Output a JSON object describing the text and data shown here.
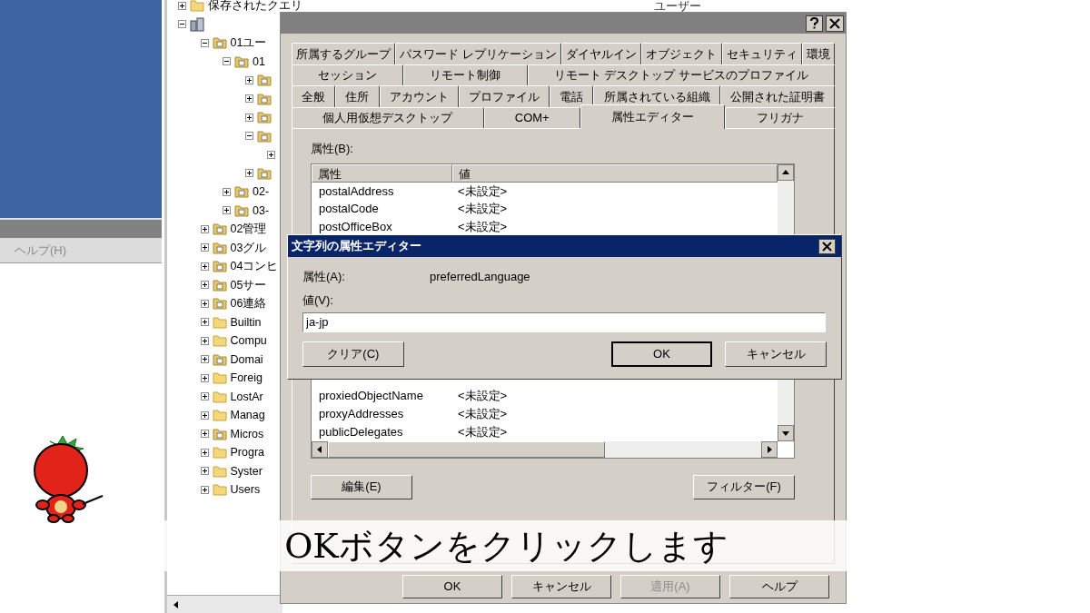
{
  "left_window": {
    "menu": [
      {
        "label": "ヘルプ(H)",
        "disabled": true
      }
    ]
  },
  "tree": [
    {
      "label": "保存されたクエリ",
      "kind": "folder",
      "expanded": false
    },
    {
      "kind": "domain",
      "expanded": true,
      "children": [
        {
          "label": "01ユー",
          "kind": "ou",
          "expanded": true,
          "children": [
            {
              "label": "01",
              "kind": "ou",
              "expanded": true,
              "children": [
                {
                  "kind": "ou",
                  "expanded": false
                },
                {
                  "kind": "ou",
                  "expanded": false
                },
                {
                  "kind": "ou",
                  "expanded": false
                },
                {
                  "kind": "ou",
                  "expanded": true,
                  "children": [
                    {
                      "expanded": false
                    }
                  ]
                },
                {
                  "kind": "ou",
                  "expanded": false
                }
              ]
            },
            {
              "label": "02-",
              "kind": "ou",
              "expanded": false
            },
            {
              "label": "03-",
              "kind": "ou",
              "expanded": false
            }
          ]
        },
        {
          "label": "02管理",
          "kind": "ou",
          "expanded": false
        },
        {
          "label": "03グル",
          "kind": "ou",
          "expanded": false
        },
        {
          "label": "04コンヒ",
          "kind": "ou",
          "expanded": false
        },
        {
          "label": "05サー",
          "kind": "ou",
          "expanded": false
        },
        {
          "label": "06連絡",
          "kind": "ou",
          "expanded": false
        },
        {
          "label": "Builtin",
          "kind": "folder",
          "expanded": false
        },
        {
          "label": "Compu",
          "kind": "folder",
          "expanded": false
        },
        {
          "label": "Domai",
          "kind": "ou",
          "expanded": false
        },
        {
          "label": "Foreig",
          "kind": "folder",
          "expanded": false
        },
        {
          "label": "LostAr",
          "kind": "folder",
          "expanded": false
        },
        {
          "label": "Manag",
          "kind": "folder",
          "expanded": false
        },
        {
          "label": "Micros",
          "kind": "ou",
          "expanded": false
        },
        {
          "label": "Progra",
          "kind": "folder",
          "expanded": false
        },
        {
          "label": "Syster",
          "kind": "folder",
          "expanded": false
        },
        {
          "label": "Users",
          "kind": "folder",
          "expanded": false
        }
      ]
    }
  ],
  "right_pane": {
    "column_header": "ユーザー"
  },
  "properties_dialog": {
    "tab_rows": [
      [
        {
          "label": "所属するグループ",
          "selected": false
        },
        {
          "label": "パスワード レプリケーション",
          "selected": false
        },
        {
          "label": "ダイヤルイン",
          "selected": false
        },
        {
          "label": "オブジェクト",
          "selected": false
        },
        {
          "label": "セキュリティ",
          "selected": false
        },
        {
          "label": "環境",
          "selected": false
        }
      ],
      [
        {
          "label": "セッション",
          "selected": false
        },
        {
          "label": "リモート制御",
          "selected": false
        },
        {
          "label": "リモート デスクトップ サービスのプロファイル",
          "selected": false
        }
      ],
      [
        {
          "label": "全般",
          "selected": false
        },
        {
          "label": "住所",
          "selected": false
        },
        {
          "label": "アカウント",
          "selected": false
        },
        {
          "label": "プロファイル",
          "selected": false
        },
        {
          "label": "電話",
          "selected": false
        },
        {
          "label": "所属されている組織",
          "selected": false
        },
        {
          "label": "公開された証明書",
          "selected": false
        }
      ],
      [
        {
          "label": "個人用仮想デスクトップ",
          "selected": false
        },
        {
          "label": "COM+",
          "selected": false
        },
        {
          "label": "属性エディター",
          "selected": true
        },
        {
          "label": "フリガナ",
          "selected": false
        }
      ]
    ],
    "attributes_label": "属性(B):",
    "table": {
      "columns": [
        "属性",
        "値"
      ],
      "rows_above": [
        [
          "postalAddress",
          "<未設定>"
        ],
        [
          "postalCode",
          "<未設定>"
        ],
        [
          "postOfficeBox",
          "<未設定>"
        ]
      ],
      "rows_below": [
        [
          "proxiedObjectName",
          "<未設定>"
        ],
        [
          "proxyAddresses",
          "<未設定>"
        ],
        [
          "publicDelegates",
          "<未設定>"
        ]
      ]
    },
    "edit_button": "編集(E)",
    "filter_button": "フィルター(F)",
    "buttons": [
      {
        "label": "OK",
        "disabled": false
      },
      {
        "label": "キャンセル",
        "disabled": false
      },
      {
        "label": "適用(A)",
        "disabled": true
      },
      {
        "label": "ヘルプ",
        "disabled": false
      }
    ]
  },
  "string_editor": {
    "title": "文字列の属性エディター",
    "attribute_label": "属性(A):",
    "attribute_value": "preferredLanguage",
    "value_label": "値(V):",
    "value": "ja-jp",
    "buttons": [
      {
        "label": "クリア(C)",
        "default": false
      },
      {
        "label": "OK",
        "default": true
      },
      {
        "label": "キャンセル",
        "default": false
      }
    ]
  },
  "subtitle": "OKボタンをクリックします"
}
